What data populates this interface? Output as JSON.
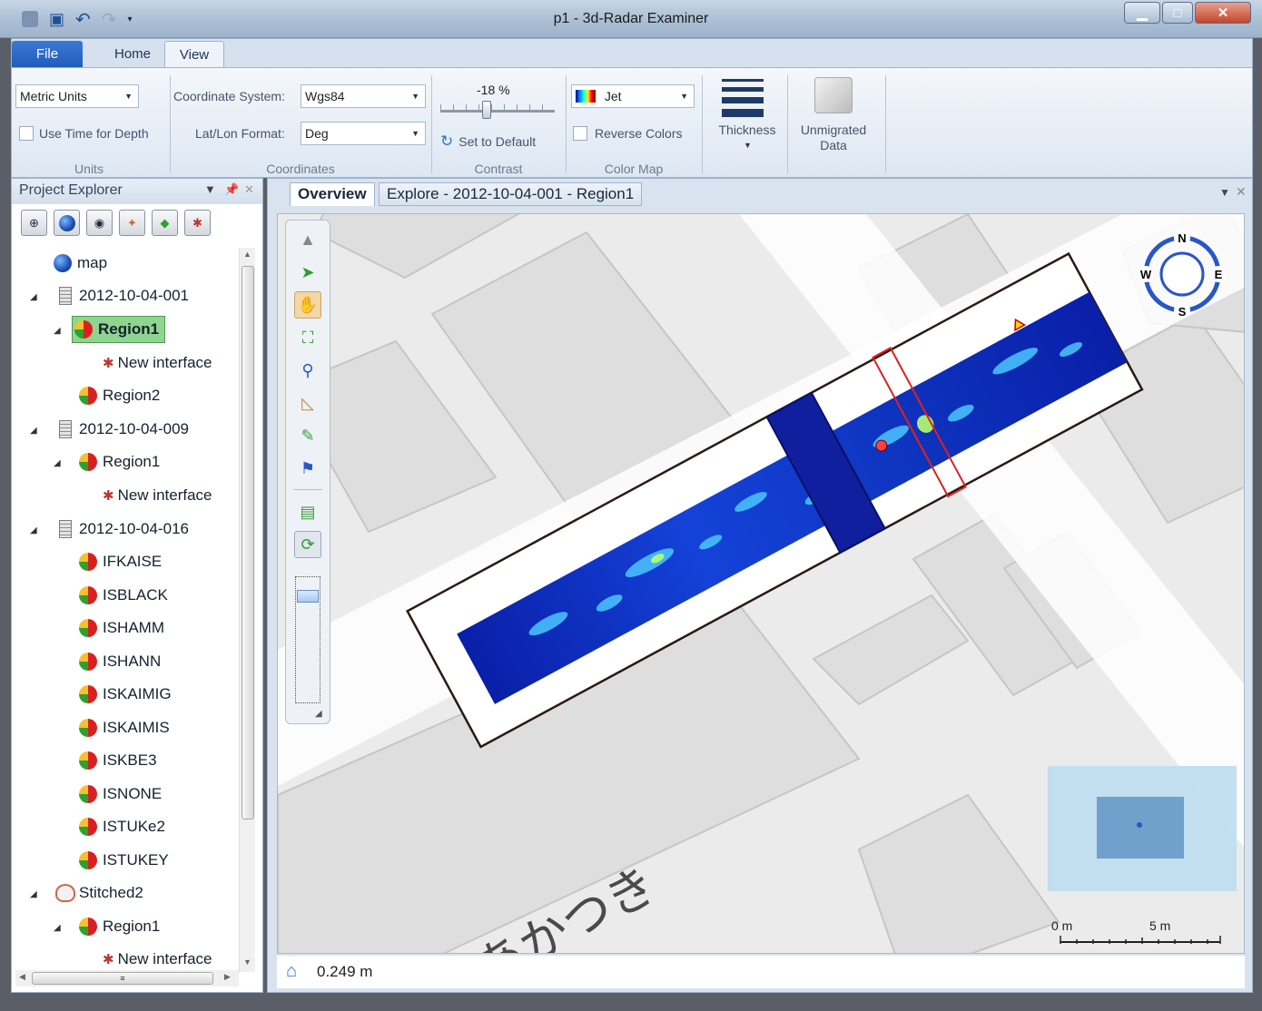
{
  "window": {
    "title": "p1 - 3d-Radar Examiner"
  },
  "ribbon": {
    "tabs": {
      "file": "File",
      "home": "Home",
      "view": "View"
    },
    "units": {
      "value": "Metric Units",
      "use_time": "Use Time for Depth",
      "group": "Units"
    },
    "coordinates": {
      "system_label": "Coordinate System:",
      "system_value": "Wgs84",
      "format_label": "Lat/Lon Format:",
      "format_value": "Deg",
      "group": "Coordinates"
    },
    "contrast": {
      "value": "-18 %",
      "fraction": 0.4,
      "reset": "Set to Default",
      "group": "Contrast"
    },
    "color_map": {
      "value": "Jet",
      "reverse": "Reverse Colors",
      "group": "Color Map"
    },
    "thickness": "Thickness",
    "unmigrated": {
      "line1": "Unmigrated",
      "line2": "Data"
    }
  },
  "explorer": {
    "title": "Project Explorer",
    "tree": {
      "map": "map",
      "d1": "2012-10-04-001",
      "d1_region1": "Region1",
      "d1_iface": "New interface",
      "d1_region2": "Region2",
      "d2": "2012-10-04-009",
      "d2_region1": "Region1",
      "d2_iface": "New interface",
      "d3": "2012-10-04-016",
      "r_ifkaise": "IFKAISE",
      "r_isblack": "ISBLACK",
      "r_ishamm": "ISHAMM",
      "r_ishann": "ISHANN",
      "r_iskaimig": "ISKAIMIG",
      "r_iskaimis": "ISKAIMIS",
      "r_iskbe3": "ISKBE3",
      "r_isnone": "ISNONE",
      "r_istuke2": "ISTUKe2",
      "r_istukey": "ISTUKEY",
      "stitched": "Stitched2",
      "st_region1": "Region1",
      "st_iface": "New interface"
    }
  },
  "document": {
    "tabs": {
      "overview": "Overview",
      "explore": "Explore - 2012-10-04-001 - Region1"
    },
    "compass": {
      "n": "N",
      "e": "E",
      "s": "S",
      "w": "W"
    },
    "map_text": "あかつき",
    "scale": {
      "start": "0 m",
      "end": "5 m"
    },
    "status": "0.249 m"
  },
  "colors": {
    "accent": "#1f5bbb",
    "selection": "#8fd48f",
    "radar_low": "#0a1fa8",
    "radar_high": "#3cf0ff"
  }
}
